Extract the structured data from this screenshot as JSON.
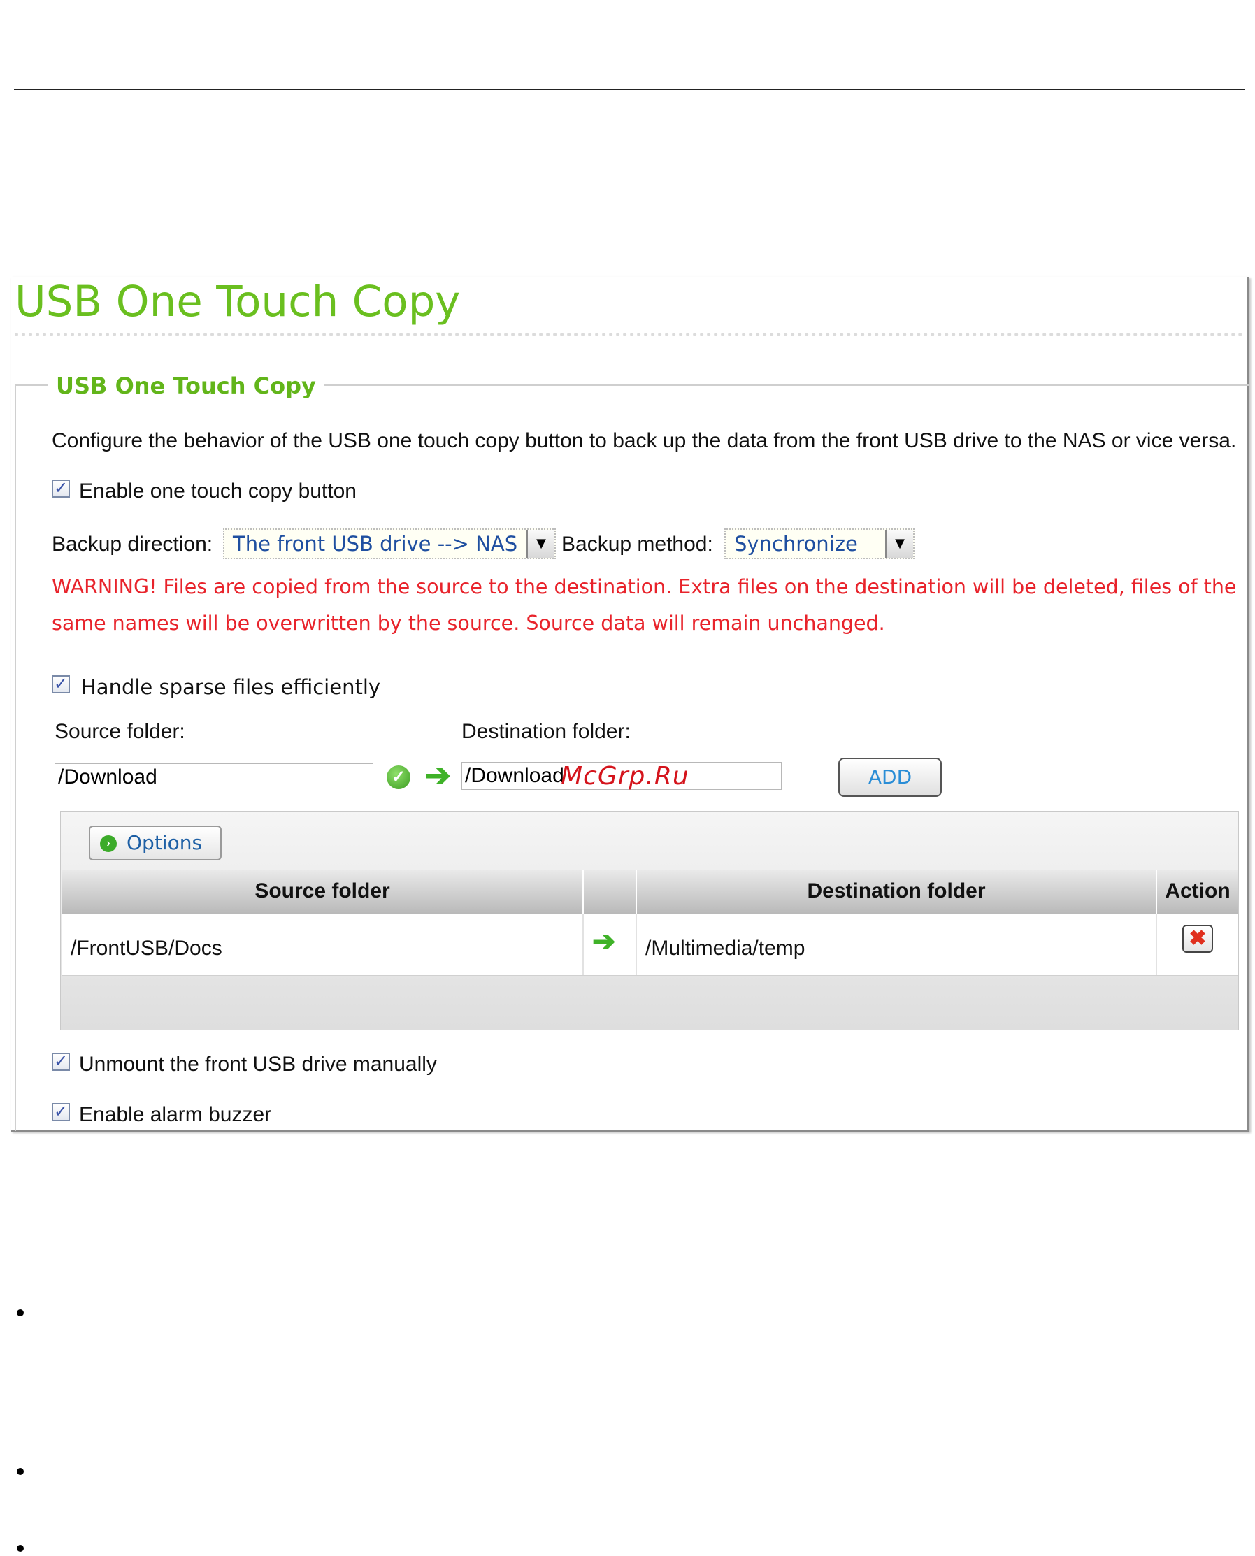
{
  "page": {
    "title": "USB One Touch Copy"
  },
  "section": {
    "legend": "USB One Touch Copy",
    "description": "Configure the behavior of the USB one touch copy button to back up the data from the front USB drive to the NAS or vice versa.",
    "enable_button_label": "Enable one touch copy button",
    "backup_direction_label": "Backup direction:",
    "backup_direction_value": "The front USB drive --> NAS",
    "backup_method_label": "Backup method:",
    "backup_method_value": "Synchronize",
    "warning": "WARNING! Files are copied from the source to the destination. Extra files on the destination will be deleted, files of the same names will be overwritten by the source. Source data will remain unchanged.",
    "sparse_label": "Handle sparse files efficiently",
    "source_folder_label": "Source folder:",
    "destination_folder_label": "Destination folder:",
    "source_folder_value": "/Download",
    "destination_folder_value": "/Download",
    "add_button": "ADD",
    "options_button": "Options",
    "table": {
      "headers": [
        "Source folder",
        "",
        "Destination folder",
        "Action"
      ],
      "rows": [
        {
          "source": "/FrontUSB/Docs",
          "destination": "/Multimedia/temp"
        }
      ]
    },
    "unmount_label": "Unmount the front USB drive manually",
    "alarm_label": "Enable alarm buzzer"
  },
  "watermark": "McGrp.Ru",
  "colors": {
    "title_green": "#6abf1f",
    "warning_red": "#e8232b",
    "link_blue": "#1f4fa0",
    "add_blue": "#2a8dd6"
  },
  "icons": [
    "check-ok-icon",
    "right-arrow-icon",
    "options-arrow-icon",
    "delete-icon",
    "checkbox-checked-icon"
  ]
}
